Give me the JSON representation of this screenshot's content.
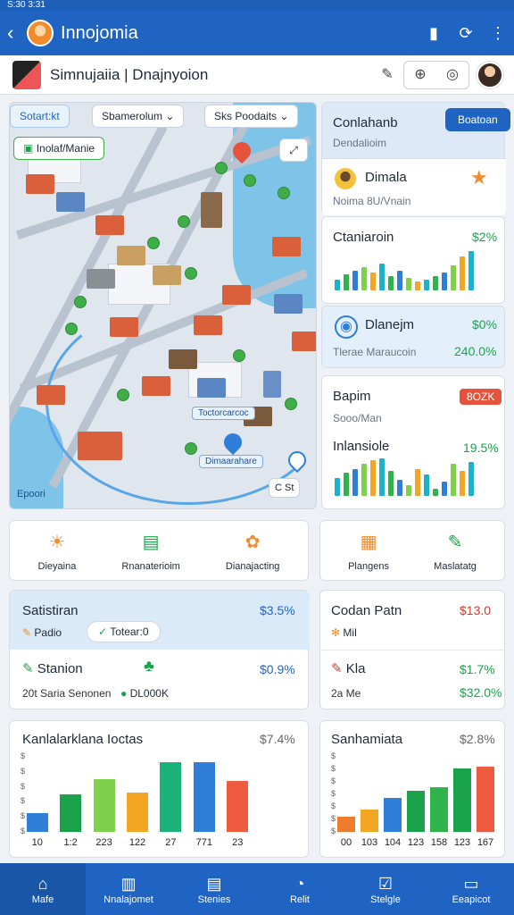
{
  "status": {
    "time": "S:30 3:31"
  },
  "appbar": {
    "title": "Innojomia",
    "back_icon": "back-arrow-icon",
    "actions": [
      "bookmark-icon",
      "sync-icon",
      "more-vertical-icon"
    ]
  },
  "toolbar": {
    "title": "Simnujaiia | Dnajnyoion",
    "icons": [
      "edit-icon",
      "zoom-icon",
      "chat-icon"
    ]
  },
  "map": {
    "search_chip": "Sotart:kt",
    "filter1": "Sbamerolum",
    "filter2": "Sks Poodaits",
    "location_chip": "Inolaf/Manie",
    "footer_label": "Epoori",
    "route_label": "Toctorcarcoc",
    "pin_label": "Dimaarahare",
    "coord": "C  St"
  },
  "panels": {
    "p1": {
      "title": "Conlahanb",
      "sub": "Dendalioim",
      "button": "Boatoan"
    },
    "p2": {
      "title": "Dimala",
      "sub": "Noima 8U/Vnain"
    },
    "p3": {
      "title": "Ctaniaroin",
      "pct": "$2%",
      "bars": [
        12,
        18,
        22,
        26,
        20,
        30,
        16,
        22,
        14,
        10,
        12,
        16,
        20,
        28,
        38,
        44
      ]
    },
    "p4": {
      "title": "Dlanejm",
      "pct": "$0%",
      "sub": "Tlerae Maraucoin",
      "value": "240.0%"
    },
    "p5": {
      "title": "Bapim",
      "badge": "8OZK",
      "sub": "Sooo/Man"
    },
    "p6": {
      "title": "Inlansiole",
      "pct": "19.5%",
      "bars": [
        20,
        26,
        30,
        36,
        40,
        42,
        28,
        18,
        12,
        30,
        24,
        8,
        16,
        36,
        28,
        38
      ]
    }
  },
  "actions_left": [
    {
      "icon": "sun-icon",
      "label": "Dieyaina"
    },
    {
      "icon": "document-icon",
      "label": "Rnanaterioim"
    },
    {
      "icon": "puzzle-icon",
      "label": "Dianajacting"
    }
  ],
  "actions_right": [
    {
      "icon": "image-icon",
      "label": "Plangens"
    },
    {
      "icon": "pen-icon",
      "label": "Maslatatg"
    }
  ],
  "stats_left": {
    "title": "Satistiran",
    "pct": "$3.5%",
    "tag": "Padio",
    "pill": "Totear:0",
    "row2_title": "Stanion",
    "row2_pct": "$0.9%",
    "row2_sub": "20t Saria Senonen",
    "row2_value": "DL000K"
  },
  "stats_right": {
    "title": "Codan Patn",
    "pct": "$13.0",
    "sub": "Mil",
    "row2_title": "Kla",
    "row2_pct": "$1.7%",
    "row2_sub": "2a Me",
    "row2_value": "$32.0%"
  },
  "chart_left": {
    "title": "Kanlalarklana Ioctas",
    "pct": "$7.4%",
    "yticks": [
      "$",
      "$",
      "$",
      "$",
      "$",
      "$"
    ],
    "colors": [
      "#2f7fd8",
      "#1aa34a",
      "#7fd04a",
      "#f3a623",
      "#1bb37a",
      "#2f7fd8",
      "#ef5b3f"
    ]
  },
  "chart_right": {
    "title": "Sanhamiata",
    "pct": "$2.8%",
    "yticks": [
      "$",
      "$",
      "$",
      "$",
      "$",
      "$",
      "$"
    ],
    "colors": [
      "#ef7b2d",
      "#f3a623",
      "#2f7fd8",
      "#1aa34a",
      "#2fb34a",
      "#1aa34a",
      "#ef5b3f"
    ]
  },
  "chart_data": [
    {
      "type": "bar",
      "title": "Kanlalarklana Ioctas",
      "categories": [
        "10",
        "1:2",
        "223",
        "122",
        "27",
        "771",
        "23"
      ],
      "values": [
        10,
        20,
        28,
        21,
        37,
        37,
        27
      ],
      "ylim": [
        0,
        40
      ]
    },
    {
      "type": "bar",
      "title": "Sanhamiata",
      "categories": [
        "00",
        "103",
        "104",
        "123",
        "158",
        "123",
        "167"
      ],
      "values": [
        8,
        12,
        18,
        22,
        24,
        34,
        35
      ],
      "ylim": [
        0,
        40
      ]
    }
  ],
  "nav": [
    {
      "icon": "home-icon",
      "label": "Mafe"
    },
    {
      "icon": "building-icon",
      "label": "Nnalajomet"
    },
    {
      "icon": "cards-icon",
      "label": "Stenies"
    },
    {
      "icon": "compass-icon",
      "label": "Relit"
    },
    {
      "icon": "checklist-icon",
      "label": "Stelgle"
    },
    {
      "icon": "monitor-icon",
      "label": "Eeapicot"
    }
  ]
}
